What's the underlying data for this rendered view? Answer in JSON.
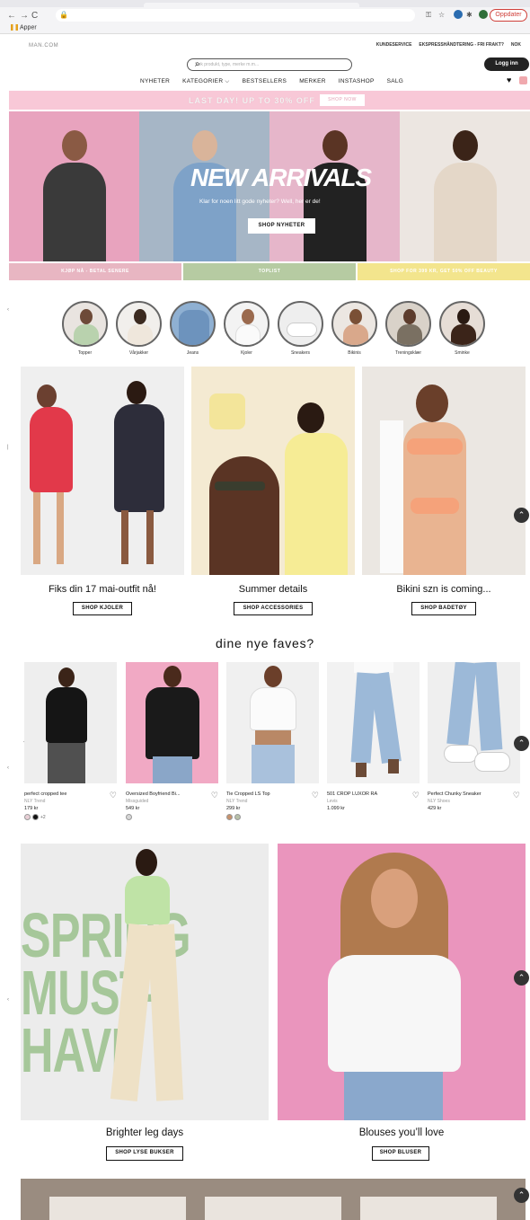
{
  "browser": {
    "back": "←",
    "forward": "→",
    "reload": "C",
    "update_label": "Oppdater",
    "bookmarks_label": "Apper"
  },
  "site": {
    "logo": "MAN.COM",
    "top_links": [
      "KUNDESERVICE",
      "EKSPRESSHÅNDTERING - FRI FRAKT?",
      "NOK"
    ],
    "search_placeholder": "Søk produkt, type, merke m.m...",
    "login_label": "Logg inn",
    "nav": [
      "NYHETER",
      "KATEGORIER ⌵",
      "BESTSELLERS",
      "MERKER",
      "INSTASHOP",
      "SALG"
    ]
  },
  "promo": {
    "text": "LAST DAY! UP TO 30% OFF",
    "button": "SHOP NOW"
  },
  "hero": {
    "title": "NEW ARRIVALS",
    "subtitle": "Klar for noen litt gode nyheter? Well, her er de!",
    "button": "SHOP NYHETER"
  },
  "strips": [
    "KJØP NÅ - BETAL SENERE",
    "TOPLIST",
    "SHOP FOR 399 KR, GET 50% OFF BEAUTY"
  ],
  "categories": [
    "Topper",
    "Vårjakker",
    "Jeans",
    "Kjoler",
    "Sneakers",
    "Bikinis",
    "Treningsklær",
    "Sminke"
  ],
  "features": [
    {
      "title": "Fiks din 17 mai-outfit nå!",
      "button": "SHOP KJOLER"
    },
    {
      "title": "Summer details",
      "button": "SHOP ACCESSORIES"
    },
    {
      "title": "Bikini szn is coming...",
      "button": "SHOP BADETØY"
    }
  ],
  "faves": {
    "title": "dine nye faves?",
    "products": [
      {
        "name": "perfect cropped tee",
        "brand": "NLY Trend",
        "price": "179 kr",
        "more": "+2"
      },
      {
        "name": "Oversized Boyfriend Bi...",
        "brand": "Missguided",
        "price": "549 kr",
        "more": ""
      },
      {
        "name": "Tie Cropped LS Top",
        "brand": "NLY Trend",
        "price": "299 kr",
        "more": ""
      },
      {
        "name": "501 CROP LUXOR RA",
        "brand": "Levis",
        "price": "1.099 kr",
        "more": ""
      },
      {
        "name": "Perfect Chunky Sneaker",
        "brand": "NLY Shoes",
        "price": "429 kr",
        "more": ""
      }
    ]
  },
  "big_cards": [
    {
      "title": "Brighter leg days",
      "button": "SHOP LYSE BUKSER",
      "overlay": "SPRING MUST-HAVE"
    },
    {
      "title": "Blouses you’ll love",
      "button": "SHOP BLUSER"
    }
  ],
  "colors": {
    "promo_pink": "#f8c8d7",
    "strip_pink": "#e8b6c2",
    "strip_green": "#b6cba2",
    "strip_yellow": "#f3e58d",
    "spring_green": "#a6c79a"
  }
}
